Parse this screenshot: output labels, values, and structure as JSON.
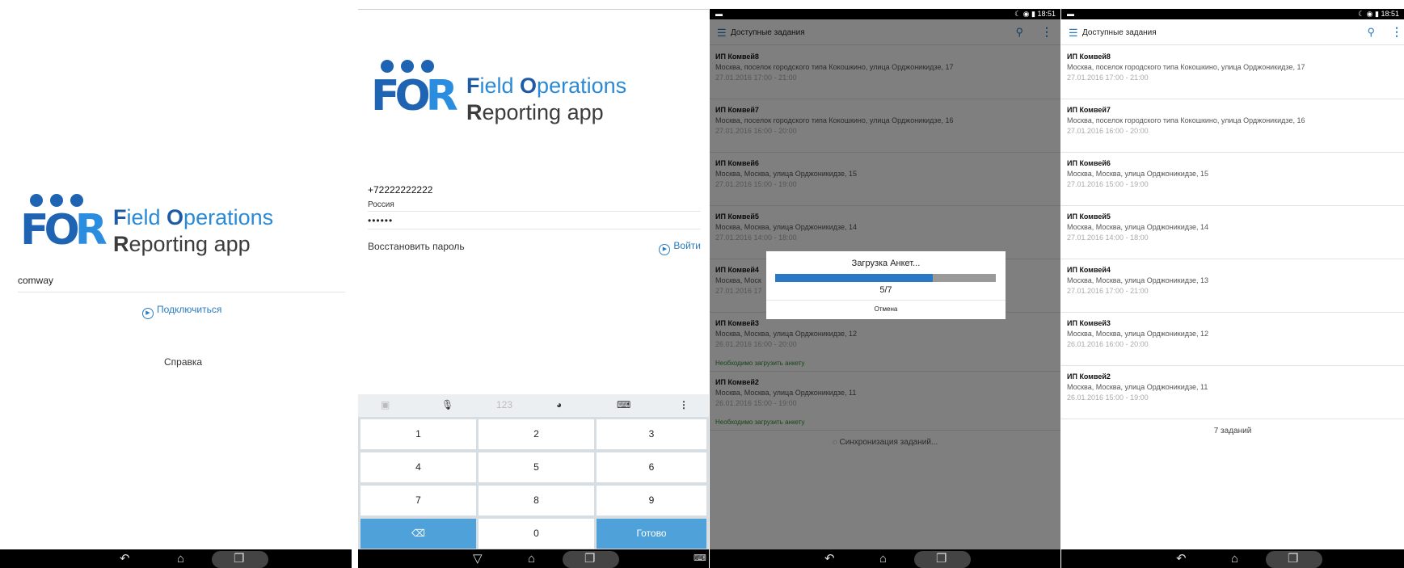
{
  "logo": {
    "mark": "FOR",
    "line1_a": "F",
    "line1_b": "ield ",
    "line1_c": "O",
    "line1_d": "perations",
    "line2_a": "R",
    "line2_b": "eporting app"
  },
  "screen1": {
    "company_value": "comway",
    "connect_label": "Подключиться",
    "help_label": "Справка"
  },
  "screen2": {
    "phone_value": "+72222222222",
    "country_label": "Россия",
    "password_value": "••••••",
    "restore_label": "Восстановить пароль",
    "login_label": "Войти",
    "keyboard": {
      "toolbar": [
        "123"
      ],
      "keys": [
        "1",
        "2",
        "3",
        "4",
        "5",
        "6",
        "7",
        "8",
        "9",
        "0"
      ],
      "done_label": "Готово"
    }
  },
  "status_time": "18:51",
  "list": {
    "title": "Доступные задания",
    "tasks": [
      {
        "name": "ИП Комвей8",
        "addr": "Москва, поселок городского типа Кокошкино, улица Орджоникидзе, 17",
        "time": "27.01.2016 17:00 - 21:00"
      },
      {
        "name": "ИП Комвей7",
        "addr": "Москва, поселок городского типа Кокошкино, улица Орджоникидзе, 16",
        "time": "27.01.2016 16:00 - 20:00"
      },
      {
        "name": "ИП Комвей6",
        "addr": "Москва, Москва, улица Орджоникидзе, 15",
        "time": "27.01.2016 15:00 - 19:00"
      },
      {
        "name": "ИП Комвей5",
        "addr": "Москва, Москва, улица Орджоникидзе, 14",
        "time": "27.01.2016 14:00 - 18:00"
      },
      {
        "name": "ИП Комвей4",
        "addr": "Москва, Москва, улица Орджоникидзе, 13",
        "time": "27.01.2016 17:00 - 21:00"
      },
      {
        "name": "ИП Комвей3",
        "addr": "Москва, Москва, улица Орджоникидзе, 12",
        "time": "26.01.2016 16:00 - 20:00"
      },
      {
        "name": "ИП Комвей2",
        "addr": "Москва, Москва, улица Орджоникидзе, 11",
        "time": "26.01.2016 15:00 - 19:00"
      }
    ],
    "short_name_4": "ИП Комвей4",
    "short_addr_4": "Москва, Моск",
    "short_time_4": "27.01.2016 17",
    "warn_label": "Необходимо загрузить анкету",
    "sync_label": "Синхронизация заданий...",
    "count_label": "7 заданий"
  },
  "dialog": {
    "title": "Загрузка Анкет...",
    "progress_text": "5/7",
    "progress_fraction": 0.714,
    "cancel_label": "Отмена"
  }
}
